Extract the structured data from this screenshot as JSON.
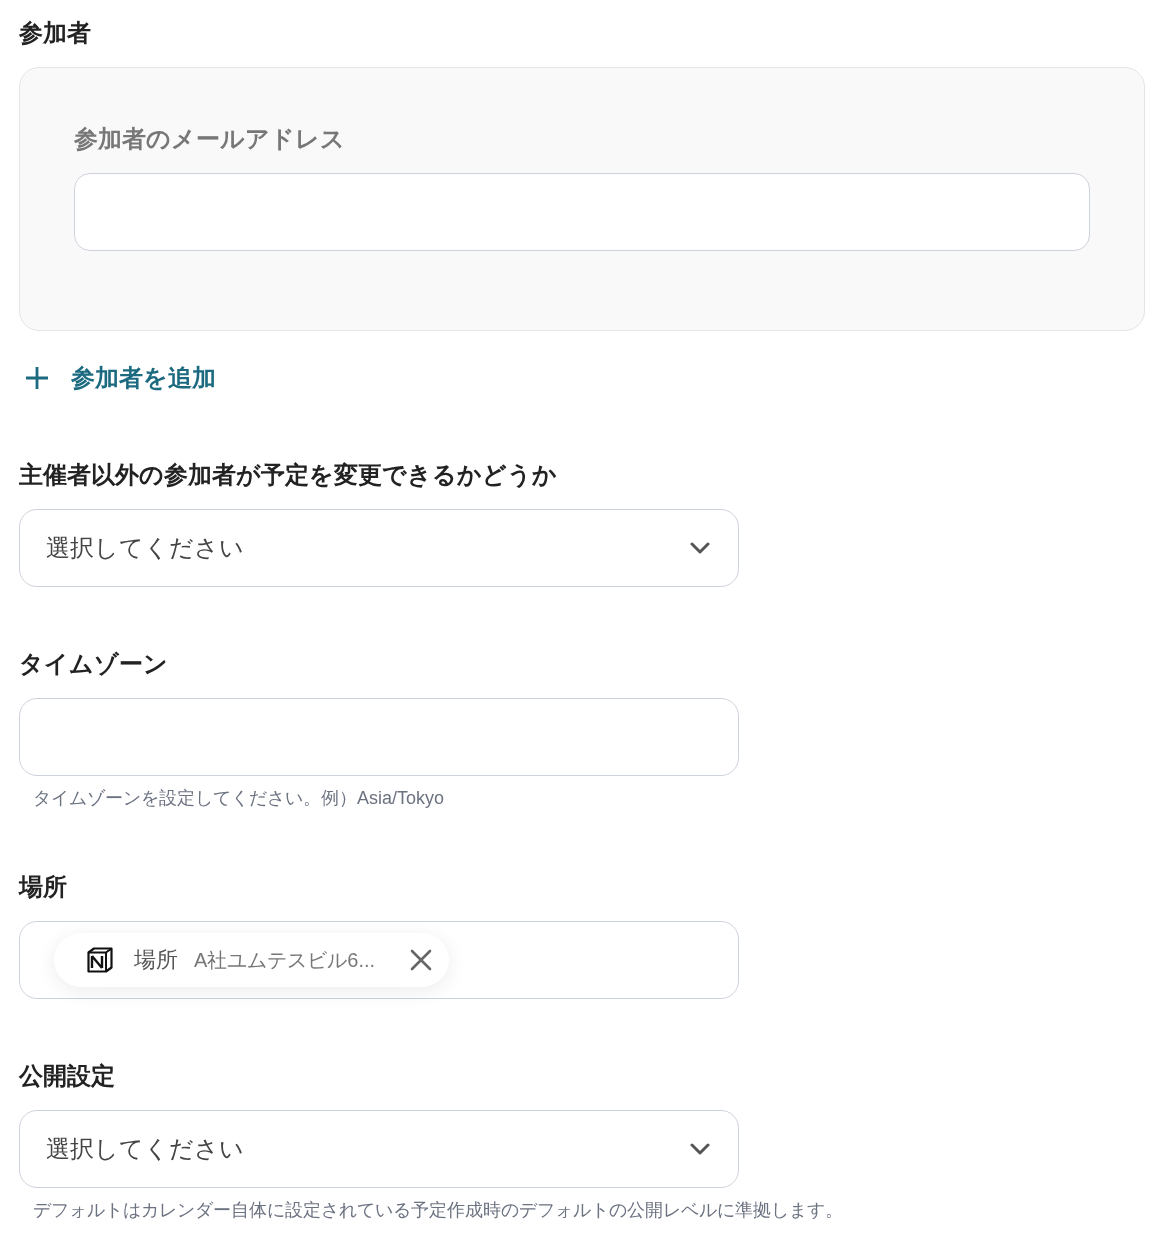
{
  "attendees": {
    "label": "参加者",
    "email_field": {
      "label": "参加者のメールアドレス"
    },
    "add_button": {
      "label": "参加者を追加"
    }
  },
  "fields": [
    {
      "kind": "select",
      "label": "主催者以外の参加者が予定を変更できるかどうか",
      "placeholder": "選択してください"
    },
    {
      "kind": "text",
      "label": "タイムゾーン",
      "hint": "タイムゾーンを設定してください。例）Asia/Tokyo"
    },
    {
      "kind": "chip",
      "label": "場所",
      "chip": {
        "label": "場所",
        "value": "A社ユムテスビル6..."
      }
    },
    {
      "kind": "select",
      "label": "公開設定",
      "placeholder": "選択してください",
      "hint": "デフォルトはカレンダー自体に設定されている予定作成時のデフォルトの公開レベルに準拠します。"
    }
  ]
}
